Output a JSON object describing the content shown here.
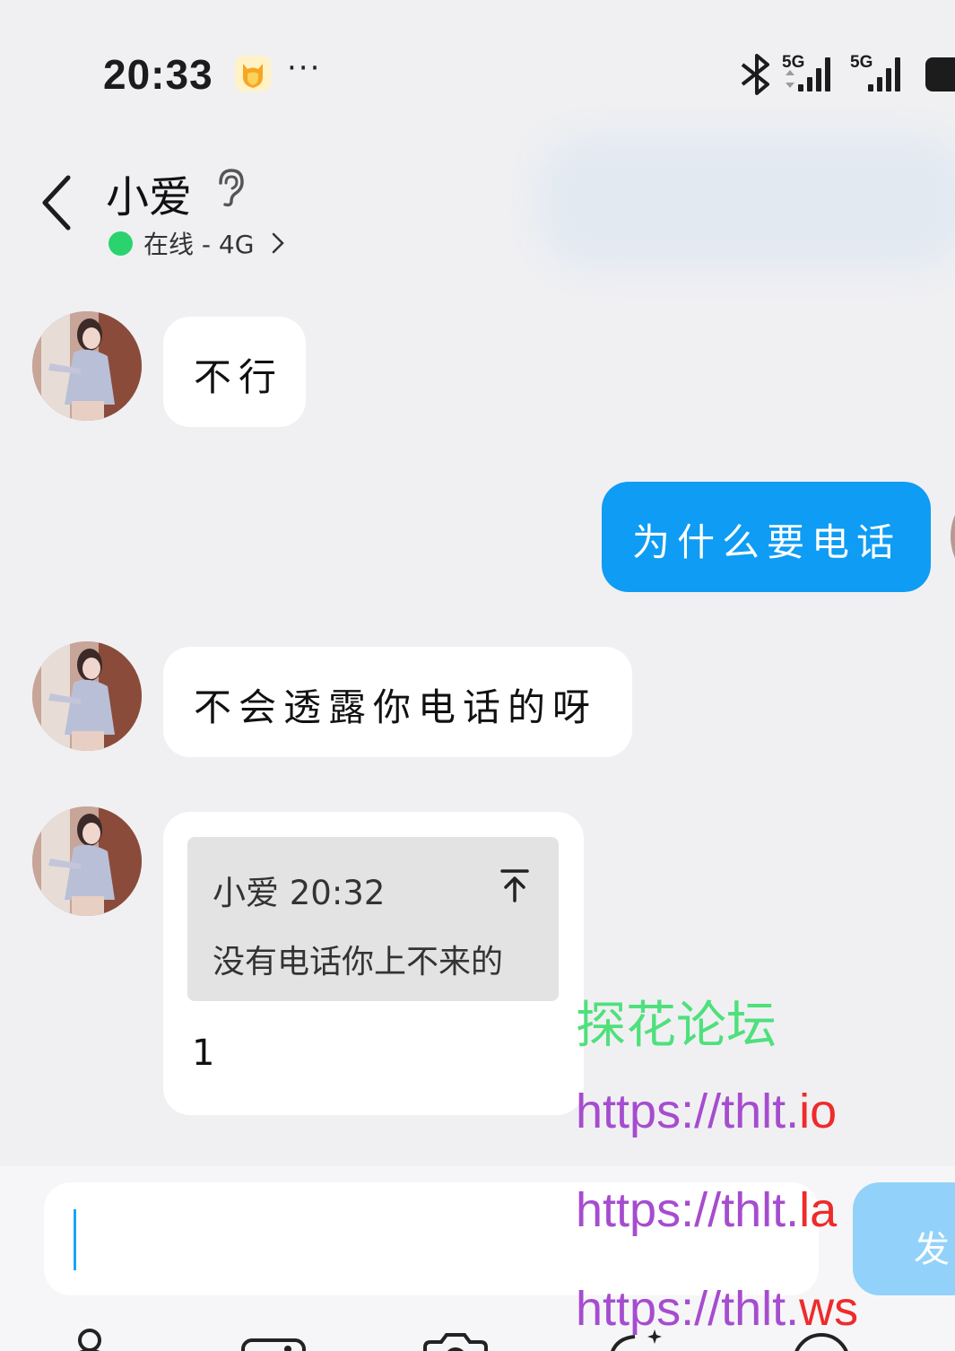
{
  "status_bar": {
    "time": "20:33",
    "overflow": "···",
    "network_1": "5G",
    "network_2": "5G",
    "icons": [
      "app-shield-icon",
      "bluetooth-icon",
      "signal-icon",
      "battery-icon"
    ]
  },
  "header": {
    "contact_name": "小爱",
    "status": "在线 - 4G",
    "icons": [
      "back-icon",
      "ear-icon",
      "chevron-right-icon"
    ],
    "online_color": "#2ad36e"
  },
  "messages": [
    {
      "side": "left",
      "text": "不行"
    },
    {
      "side": "right",
      "text": "为什么要电话"
    },
    {
      "side": "left",
      "text": "不会透露你电话的呀"
    },
    {
      "side": "left",
      "quote": {
        "header": "小爱 20:32",
        "text": "没有电话你上不来的"
      },
      "text": "1"
    }
  ],
  "watermark": {
    "title": "探花论坛",
    "urls": [
      {
        "base": "https://thlt.",
        "tld": "io"
      },
      {
        "base": "https://thlt.",
        "tld": "la"
      },
      {
        "base": "https://thlt.",
        "tld": "ws"
      }
    ]
  },
  "composer": {
    "send_label": "发"
  },
  "colors": {
    "background": "#f0f0f3",
    "outgoing_bubble": "#0e9cf4",
    "incoming_bubble": "#ffffff",
    "send_button": "#92d2fa"
  }
}
